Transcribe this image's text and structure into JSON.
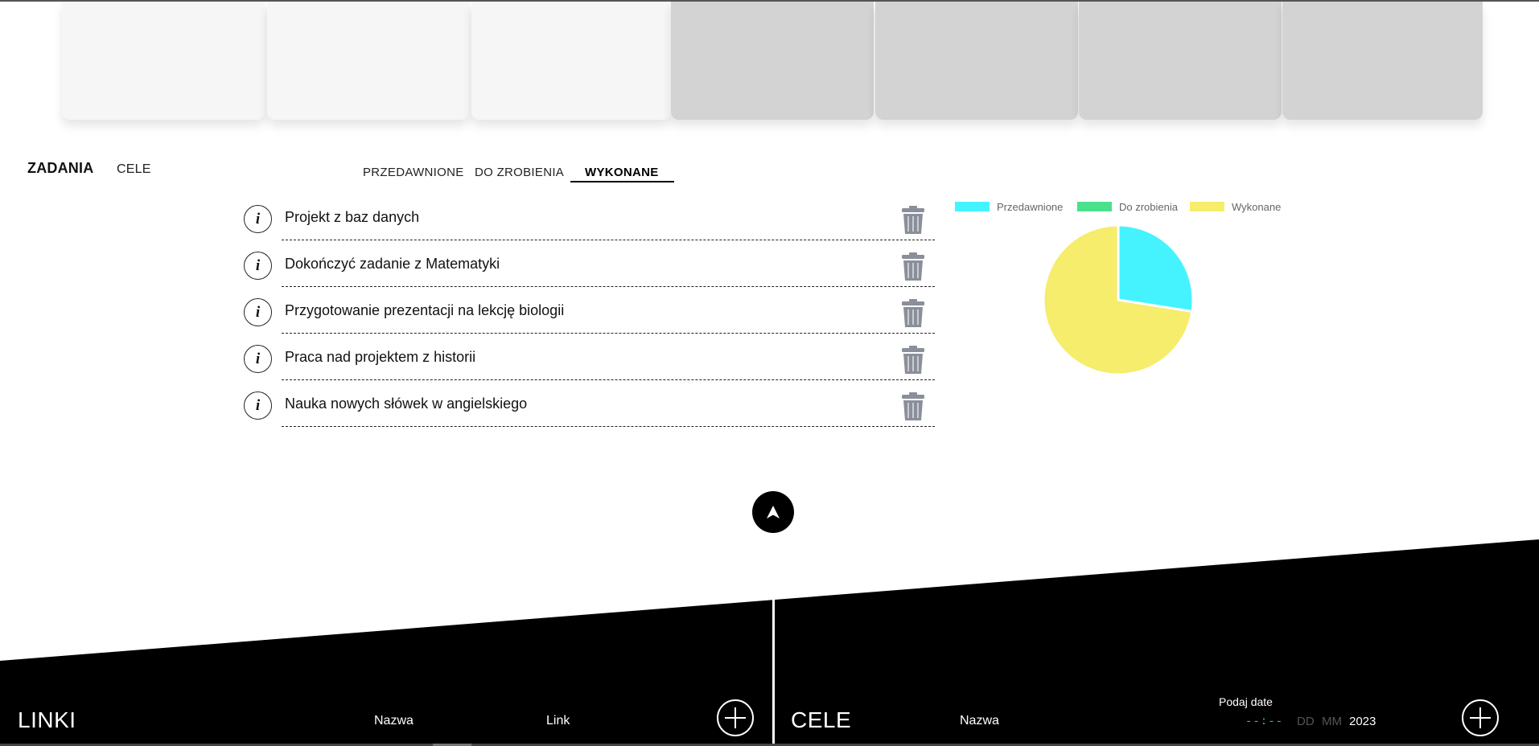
{
  "main_tabs": [
    {
      "label": "ZADANIA",
      "active": true
    },
    {
      "label": "CELE",
      "active": false
    }
  ],
  "sub_tabs": [
    {
      "label": "PRZEDAWNIONE",
      "active": false
    },
    {
      "label": "DO ZROBIENIA",
      "active": false
    },
    {
      "label": "WYKONANE",
      "active": true
    }
  ],
  "tasks": [
    {
      "label": "Projekt z baz danych"
    },
    {
      "label": "Dokończyć zadanie z Matematyki"
    },
    {
      "label": "Przygotowanie prezentacji na lekcję biologii"
    },
    {
      "label": "Praca nad projektem z historii"
    },
    {
      "label": "Nauka nowych słówek w angielskiego"
    }
  ],
  "icons": {
    "info": "i",
    "trash": "trash-icon",
    "scroll_top": "arrow-up-icon",
    "add": "plus-icon"
  },
  "chart_data": {
    "type": "pie",
    "labels": [
      "Przedawnione",
      "Do zrobienia",
      "Wykonane"
    ],
    "values": [
      27.5,
      0,
      72.5
    ],
    "colors": [
      "#45f3ff",
      "#4ae08c",
      "#f5ed6b"
    ],
    "legend_position": "top"
  },
  "footer": {
    "links": {
      "title": "LINKI",
      "name_label": "Nazwa",
      "link_label": "Link"
    },
    "goals": {
      "title": "CELE",
      "name_label": "Nazwa",
      "date_label": "Podaj date",
      "time_placeholder": "--:--",
      "day_placeholder": "DD",
      "month_placeholder": "MM",
      "year_value": "2023"
    }
  },
  "colors": {
    "card_light": "#f6f6f6",
    "card_dark": "#d4d3d4",
    "footer": "#000000",
    "time_field": "#2ecc71"
  }
}
